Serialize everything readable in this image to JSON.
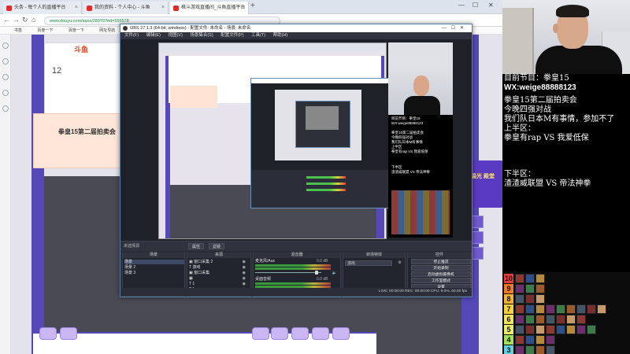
{
  "browser": {
    "tabs": [
      {
        "label": "头条 - 每个人的直播平台"
      },
      {
        "label": "我的资料 - 个人中心 - 斗鱼"
      },
      {
        "label": "格斗游戏直播间_斗鱼直播平台"
      }
    ],
    "new_tab": "+",
    "url": "www.douyu.com/topic/28070?rid=555578",
    "bookmarks": [
      "书签",
      "百度一下",
      "百度一下",
      "网址导航"
    ],
    "page_logo": "斗鱼",
    "page_number": "12",
    "page_card_title": "拳皇15第二届拍卖会",
    "promo_text": "温光 殿堂",
    "window_controls": [
      "—",
      "☐",
      "✕"
    ]
  },
  "obs": {
    "title": "OBS 27.1.3 (64-bit, windows) - 配置文件: 未命名 - 场景: 未命名",
    "menu": [
      "文件(F)",
      "编辑(E)",
      "视图(V)",
      "场景集合(S)",
      "配置文件(P)",
      "工具(T)",
      "帮助(H)"
    ],
    "no_scene": "未选择源",
    "src_buttons": [
      "属性",
      "滤镜"
    ],
    "scenes": {
      "header": "场景",
      "items": [
        "场景",
        "场景 2",
        "场景 3"
      ]
    },
    "sources": {
      "header": "来源",
      "items": [
        "窗口采集 2",
        "游戏",
        "窗口采集",
        "",
        "1",
        "1s"
      ]
    },
    "mixer": {
      "header": "混音器",
      "items": [
        "麦克风/Aux",
        "桌面音频"
      ],
      "db_values": [
        "0.0 dB",
        "0.0 dB"
      ]
    },
    "transitions": {
      "header": "转场特效",
      "value": "淡出"
    },
    "controls": {
      "header": "控件",
      "items": [
        "停止推流",
        "开始录制",
        "启动虚拟摄像机",
        "工作室模式",
        "设置",
        "退出"
      ]
    },
    "status": "LIVE: 00:00:00   REC: 00:00:00   CPU: 9.0%, 60.00 fps"
  },
  "preview": {
    "cam_lines": [
      "目前节目：拳皇15",
      "WX:weige88888123",
      "拳皇15第二届拍卖会",
      "今晚四强对战",
      "我们队日本M有事情",
      "上半区",
      "拳皇有rap VS 我爱低保",
      "下半区",
      "渣渣威联盟 VS 帝法神拳"
    ]
  },
  "info": {
    "lines": [
      {
        "text": "目前节目：拳皇15",
        "bold": false
      },
      {
        "text": "WX:weige88888123",
        "bold": true
      },
      {
        "text": "",
        "bold": false
      },
      {
        "text": "拳皇15第二届拍卖会",
        "bold": false
      },
      {
        "text": "今晚四强对战",
        "bold": false
      },
      {
        "text": "我们队日本M有事情，参加不了",
        "bold": false
      },
      {
        "text": "上半区：",
        "bold": false
      },
      {
        "text": "拳皇有rap VS 我爱低保",
        "bold": false
      },
      {
        "text": "",
        "bold": false
      },
      {
        "text": "",
        "bold": false
      },
      {
        "text": "下半区：",
        "bold": false
      },
      {
        "text": "渣渣威联盟 VS 帝法神拳",
        "bold": false
      }
    ]
  },
  "tier": {
    "rows": [
      {
        "num": "10",
        "color": "#e63b3b",
        "count": 3
      },
      {
        "num": "9",
        "color": "#f07a2a",
        "count": 3
      },
      {
        "num": "8",
        "color": "#f2b23a",
        "count": 3
      },
      {
        "num": "7",
        "color": "#f5d23a",
        "count": 9
      },
      {
        "num": "6",
        "color": "#f2e35a",
        "count": 7
      },
      {
        "num": "5",
        "color": "#e8ec6a",
        "count": 8
      },
      {
        "num": "4",
        "color": "#a4e05a",
        "count": 4
      },
      {
        "num": "3",
        "color": "#5ed0e0",
        "count": 4
      }
    ]
  }
}
